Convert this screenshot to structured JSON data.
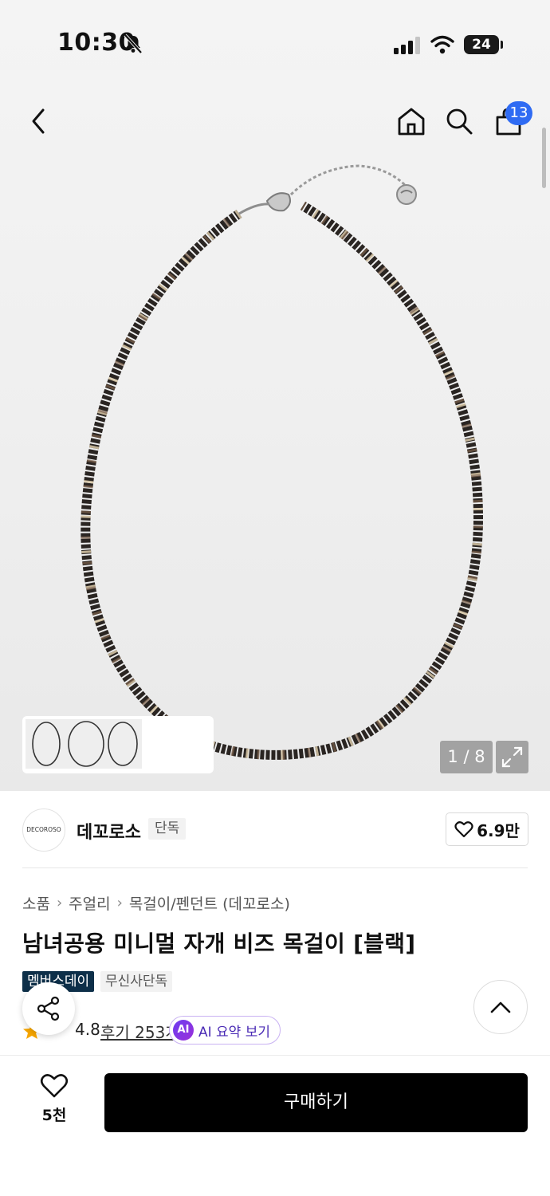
{
  "status_bar": {
    "time": "10:30",
    "battery": "24"
  },
  "header": {
    "cart_count": "13"
  },
  "gallery": {
    "page_indicator": "1 / 8"
  },
  "brand": {
    "logo_text": "DECOROSO",
    "name": "데꼬로소",
    "badge": "단독",
    "likes": "6.9만"
  },
  "breadcrumb": [
    "소품",
    "주얼리",
    "목걸이/펜던트 (데꼬로소)"
  ],
  "product": {
    "title": "남녀공용 미니멀 자개 비즈 목걸이 [블랙]",
    "tags": [
      "멤버스데이",
      "무신사단독"
    ],
    "rating": "4.8",
    "reviews": "후기 253개",
    "ai_summary": "AI 요약 보기",
    "ai_badge": "AI"
  },
  "bottom_bar": {
    "wish_count": "5천",
    "buy_label": "구매하기"
  },
  "colors": {
    "accent_blue": "#2f6bf3",
    "tag_navy": "#0d2f49",
    "ai_purple": "#6d3cf0",
    "star": "#f7a600"
  }
}
